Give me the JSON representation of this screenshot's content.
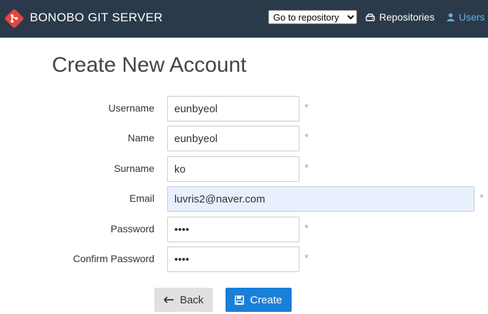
{
  "header": {
    "brand": "BONOBO GIT SERVER",
    "repo_select": "Go to repository",
    "nav_repositories": "Repositories",
    "nav_users": "Users"
  },
  "page": {
    "title": "Create New Account"
  },
  "form": {
    "fields": [
      {
        "label": "Username",
        "value": "eunbyeol",
        "required": "*"
      },
      {
        "label": "Name",
        "value": "eunbyeol",
        "required": "*"
      },
      {
        "label": "Surname",
        "value": "ko",
        "required": "*"
      },
      {
        "label": "Email",
        "value": "luvris2@naver.com",
        "required": "*"
      },
      {
        "label": "Password",
        "value": "••••",
        "required": "*"
      },
      {
        "label": "Confirm Password",
        "value": "••••",
        "required": "*"
      }
    ],
    "back_label": "Back",
    "create_label": "Create"
  },
  "colors": {
    "header_bg": "#2b3a4a",
    "brand_accent": "#e4473b",
    "primary": "#1a7fd8",
    "users_link": "#6ab0e8"
  }
}
